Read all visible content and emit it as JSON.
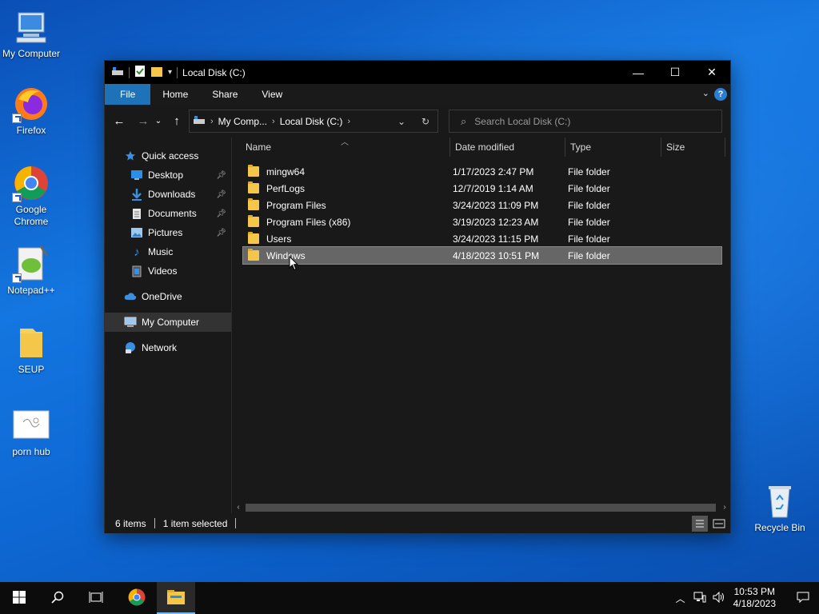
{
  "desktop": {
    "icons": [
      {
        "label": "My Computer"
      },
      {
        "label": "Firefox"
      },
      {
        "label": "Google Chrome"
      },
      {
        "label": "Notepad++"
      },
      {
        "label": "SEUP"
      },
      {
        "label": "porn hub"
      },
      {
        "label": "Recycle Bin"
      }
    ]
  },
  "window": {
    "title": "Local Disk (C:)",
    "controls": {
      "minimize": "—",
      "maximize": "☐",
      "close": "✕"
    },
    "ribbon_tabs": [
      "File",
      "Home",
      "Share",
      "View"
    ],
    "help": "?",
    "address": {
      "crumbs": [
        "My Comp...",
        "Local Disk (C:)"
      ]
    },
    "search": {
      "placeholder": "Search Local Disk (C:)"
    },
    "nav": [
      {
        "label": "Quick access",
        "icon": "star-icon"
      },
      {
        "label": "Desktop",
        "icon": "desktop-icon",
        "pinned": true
      },
      {
        "label": "Downloads",
        "icon": "download-icon",
        "pinned": true
      },
      {
        "label": "Documents",
        "icon": "documents-icon",
        "pinned": true
      },
      {
        "label": "Pictures",
        "icon": "pictures-icon",
        "pinned": true
      },
      {
        "label": "Music",
        "icon": "music-icon"
      },
      {
        "label": "Videos",
        "icon": "videos-icon"
      },
      {
        "label": "OneDrive",
        "icon": "cloud-icon"
      },
      {
        "label": "My Computer",
        "icon": "computer-icon",
        "selected": true
      },
      {
        "label": "Network",
        "icon": "network-icon"
      }
    ],
    "columns": [
      "Name",
      "Date modified",
      "Type",
      "Size"
    ],
    "files": [
      {
        "name": "mingw64",
        "date": "1/17/2023 2:47 PM",
        "type": "File folder"
      },
      {
        "name": "PerfLogs",
        "date": "12/7/2019 1:14 AM",
        "type": "File folder"
      },
      {
        "name": "Program Files",
        "date": "3/24/2023 11:09 PM",
        "type": "File folder"
      },
      {
        "name": "Program Files (x86)",
        "date": "3/19/2023 12:23 AM",
        "type": "File folder"
      },
      {
        "name": "Users",
        "date": "3/24/2023 11:15 PM",
        "type": "File folder"
      },
      {
        "name": "Windows",
        "date": "4/18/2023 10:51 PM",
        "type": "File folder",
        "selected": true
      }
    ],
    "status": {
      "count": "6 items",
      "selection": "1 item selected"
    }
  },
  "taskbar": {
    "clock_time": "10:53 PM",
    "clock_date": "4/18/2023"
  },
  "colors": {
    "accent": "#1e72b7",
    "folder": "#f4c64a",
    "selection": "#666666"
  }
}
